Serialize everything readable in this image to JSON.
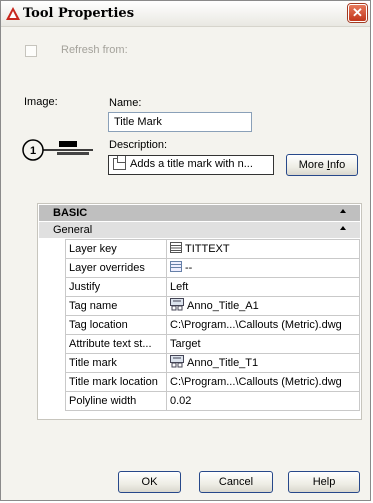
{
  "window": {
    "title": "Tool Properties",
    "close_symbol": "✕"
  },
  "refresh": {
    "label": "Refresh from:",
    "checked": false
  },
  "image": {
    "label": "Image:",
    "preview_icon": "title-mark-preview-icon"
  },
  "name": {
    "label": "Name:",
    "value": "Title Mark"
  },
  "description": {
    "label": "Description:",
    "value": "Adds a title mark with n..."
  },
  "buttons": {
    "more_info": {
      "prefix": "More ",
      "accel": "I",
      "suffix": "nfo"
    },
    "ok": "OK",
    "cancel": "Cancel",
    "help": "Help"
  },
  "panel": {
    "section": "BASIC",
    "group": "General",
    "rows": [
      {
        "name": "Layer key",
        "value": "TITTEXT",
        "icon": "layer-key-icon"
      },
      {
        "name": "Layer overrides",
        "value": "--",
        "icon": "layer-overrides-icon"
      },
      {
        "name": "Justify",
        "value": "Left",
        "icon": ""
      },
      {
        "name": "Tag name",
        "value": "Anno_Title_A1",
        "icon": "block-icon"
      },
      {
        "name": "Tag location",
        "value": "C:\\Program...\\Callouts (Metric).dwg",
        "icon": ""
      },
      {
        "name": "Attribute text st...",
        "value": "Target",
        "icon": ""
      },
      {
        "name": "Title mark",
        "value": "Anno_Title_T1",
        "icon": "block-icon"
      },
      {
        "name": "Title mark location",
        "value": "C:\\Program...\\Callouts (Metric).dwg",
        "icon": ""
      },
      {
        "name": "Polyline width",
        "value": "0.02",
        "icon": ""
      }
    ]
  },
  "colors": {
    "title_icon_red": "#c8281e",
    "close_red": "#c1361b",
    "section_header": "#bfbfbf",
    "group_header": "#e0e0e0"
  }
}
